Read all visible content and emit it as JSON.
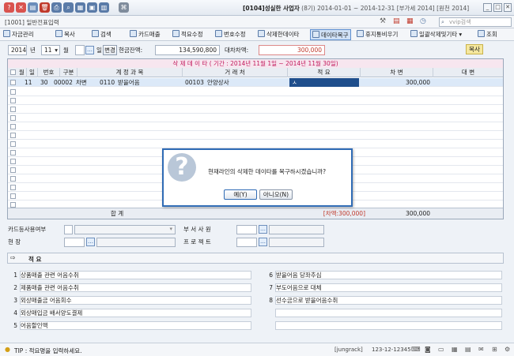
{
  "window": {
    "company_code": "[0104]",
    "company_name": "성실한 사업자",
    "fiscal_no": "(8기)",
    "period": "2014-01-01 ~ 2014-12-31",
    "vat": "[부가세 2014]",
    "withholding": "[원천 2014]",
    "screen_title": "[1001] 일반전표입력",
    "search_placeholder": "vvip검색"
  },
  "toolbar": [
    {
      "label": "자금관리"
    },
    {
      "label": "복사"
    },
    {
      "label": "검색"
    },
    {
      "label": "카드매출"
    },
    {
      "label": "적요수정"
    },
    {
      "label": "번호수정"
    },
    {
      "label": "삭제한데이타"
    },
    {
      "label": "데이타복구"
    },
    {
      "label": "휴지통비우기"
    },
    {
      "label": "일괄삭제및기타"
    },
    {
      "label": "조회"
    }
  ],
  "filter": {
    "year": "2014",
    "year_unit": "년",
    "month": "11",
    "month_unit": "월",
    "day_unit": "일",
    "change_btn": "변경",
    "cash_label": "현금잔액:",
    "cash_value": "134,590,800",
    "diff_label": "대차차액:",
    "diff_value": "300,000",
    "copy_btn": "복사"
  },
  "grid": {
    "title": "삭 제 데 이 타  ( 기간 : 2014년 11월 1일 ~ 2014년 11월 30일)",
    "headers": [
      "월",
      "일",
      "번호",
      "구분",
      "계 정 과 목",
      "거 래 처",
      "적 요",
      "차 변",
      "대 변"
    ],
    "rows": [
      {
        "month": "11",
        "day": "30",
        "no": "00002",
        "type": "차변",
        "acct_code": "0110",
        "acct_name": "받을어음",
        "vendor_code": "00103",
        "vendor_name": "안양상사",
        "memo": "ㅅ",
        "debit": "300,000",
        "credit": ""
      }
    ],
    "sum_label": "합            계",
    "sum_diff": "[차액:300,000]",
    "sum_debit": "300,000"
  },
  "form": {
    "card_user": "카드등사용여부",
    "dept_staff": "부  서  사  원",
    "site": "현           장",
    "project": "프  로  젝  트"
  },
  "memo": {
    "header": "적 요",
    "items": [
      {
        "no": "1",
        "text": "상품매출 관련 어음수취"
      },
      {
        "no": "2",
        "text": "제품매출 관련 어음수취"
      },
      {
        "no": "3",
        "text": "외상매출금 어음회수"
      },
      {
        "no": "4",
        "text": "외상매입금 배서양도결제"
      },
      {
        "no": "5",
        "text": "어음할인액"
      },
      {
        "no": "6",
        "text": "받을어음 당좌추심"
      },
      {
        "no": "7",
        "text": "부도어음으로 대체"
      },
      {
        "no": "8",
        "text": "선수금으로 받을어음수취"
      }
    ]
  },
  "status": {
    "tip": "TIP : 적요명을 입력하세요.",
    "user": "[jungrack]",
    "bizno": "123-12-12345"
  },
  "dialog": {
    "message": "현재라인의 삭제한 데이타를 복구하시겠습니까?",
    "yes": "예(Y)",
    "no": "아니오(N)"
  }
}
